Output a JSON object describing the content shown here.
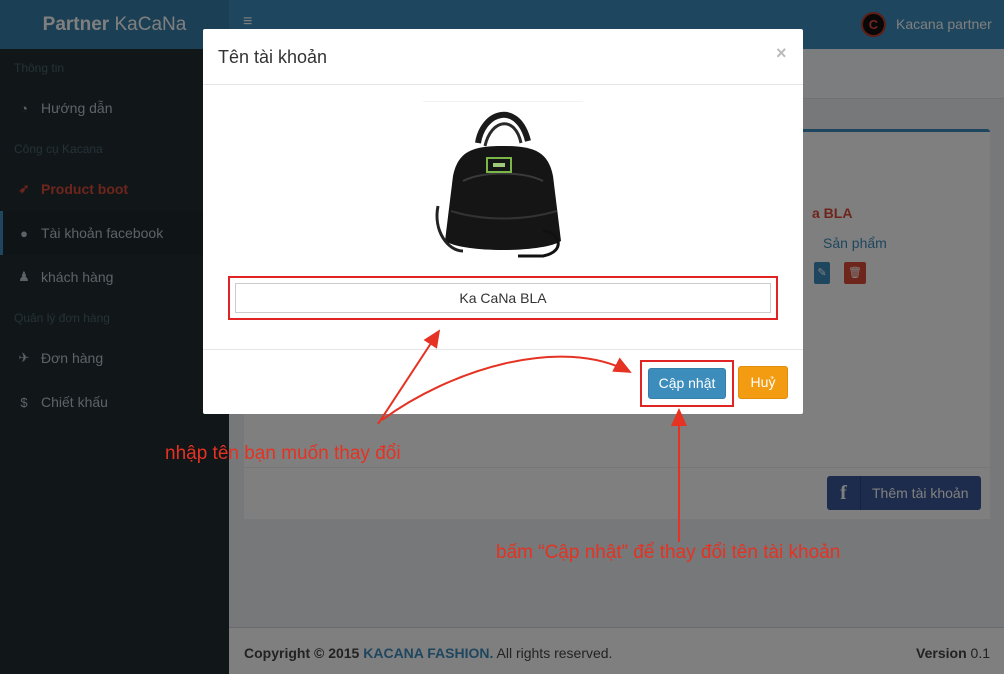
{
  "header": {
    "logo_bold": "Partner",
    "logo_rest": " KaCaNa",
    "menu_icon": "hamburger-icon",
    "user_avatar_letter": "C",
    "user_name": "Kacana partner"
  },
  "sidebar": {
    "section_info": "Thông tin",
    "section_tools": "Công cụ Kacana",
    "section_orders": "Quản lý đơn hàng",
    "items": [
      {
        "label": "Hướng dẫn",
        "icon": "dashboard-icon"
      },
      {
        "label": "Product boot",
        "icon": "rocket-icon"
      },
      {
        "label": "Tài khoản facebook",
        "icon": "globe-icon"
      },
      {
        "label": "khách hàng",
        "icon": "user-icon"
      },
      {
        "label": "Đơn hàng",
        "icon": "plane-icon"
      },
      {
        "label": "Chiết khấu",
        "icon": "dollar-icon"
      }
    ]
  },
  "background": {
    "account_name_partial": "a BLA",
    "product_link": "Sản phẩm",
    "add_account_button": "Thêm tài khoản"
  },
  "modal": {
    "title": "Tên tài khoản",
    "close": "×",
    "account_name_value": "Ka CaNa BLA",
    "update_button": "Cập nhật",
    "cancel_button": "Huỷ"
  },
  "annotations": {
    "input_hint": "nhập tên bạn muốn thay đổi",
    "button_hint": "bấm “Cập nhật” để thay đổi tên tài khoản"
  },
  "footer": {
    "copyright_prefix": "Copyright © 2015",
    "brand": "KACANA FASHION.",
    "rights": " All rights reserved.",
    "version_label": "Version",
    "version_number": " 0.1"
  },
  "colors": {
    "primary": "#3c8dbc",
    "danger": "#dd4b39",
    "warning": "#f39c12",
    "annotation": "#e53222",
    "facebook": "#3b5998"
  }
}
